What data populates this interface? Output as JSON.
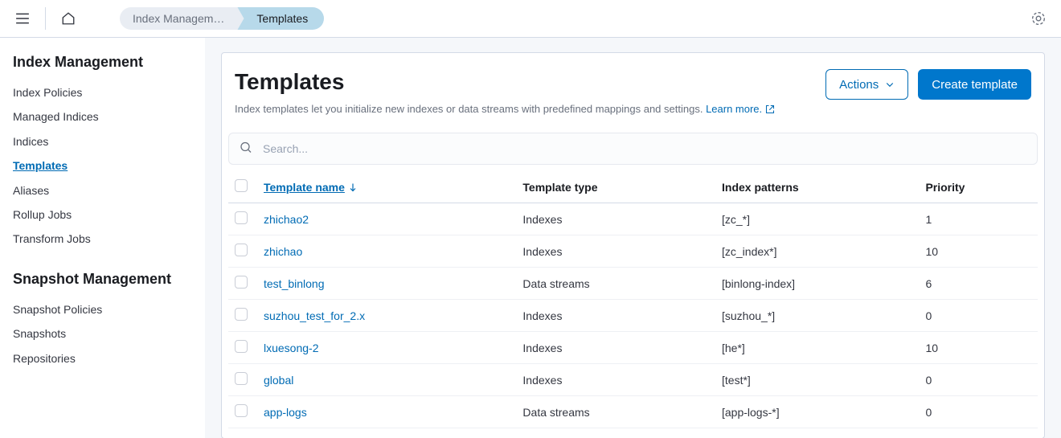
{
  "breadcrumbs": {
    "first": "Index Managem…",
    "second": "Templates"
  },
  "sidebar": {
    "group1": {
      "title": "Index Management",
      "items": [
        {
          "label": "Index Policies",
          "active": false
        },
        {
          "label": "Managed Indices",
          "active": false
        },
        {
          "label": "Indices",
          "active": false
        },
        {
          "label": "Templates",
          "active": true
        },
        {
          "label": "Aliases",
          "active": false
        },
        {
          "label": "Rollup Jobs",
          "active": false
        },
        {
          "label": "Transform Jobs",
          "active": false
        }
      ]
    },
    "group2": {
      "title": "Snapshot Management",
      "items": [
        {
          "label": "Snapshot Policies",
          "active": false
        },
        {
          "label": "Snapshots",
          "active": false
        },
        {
          "label": "Repositories",
          "active": false
        }
      ]
    }
  },
  "page": {
    "title": "Templates",
    "subtitle_prefix": "Index templates let you initialize new indexes or data streams with predefined mappings and settings. ",
    "learn_more": "Learn more.",
    "actions_label": "Actions",
    "create_label": "Create template",
    "search_placeholder": "Search..."
  },
  "table": {
    "headers": {
      "name": "Template name",
      "type": "Template type",
      "patterns": "Index patterns",
      "priority": "Priority"
    },
    "rows": [
      {
        "name": "zhichao2",
        "type": "Indexes",
        "patterns": "[zc_*]",
        "priority": "1"
      },
      {
        "name": "zhichao",
        "type": "Indexes",
        "patterns": "[zc_index*]",
        "priority": "10"
      },
      {
        "name": "test_binlong",
        "type": "Data streams",
        "patterns": "[binlong-index]",
        "priority": "6"
      },
      {
        "name": "suzhou_test_for_2.x",
        "type": "Indexes",
        "patterns": "[suzhou_*]",
        "priority": "0"
      },
      {
        "name": "lxuesong-2",
        "type": "Indexes",
        "patterns": "[he*]",
        "priority": "10"
      },
      {
        "name": "global",
        "type": "Indexes",
        "patterns": "[test*]",
        "priority": "0"
      },
      {
        "name": "app-logs",
        "type": "Data streams",
        "patterns": "[app-logs-*]",
        "priority": "0"
      }
    ]
  }
}
